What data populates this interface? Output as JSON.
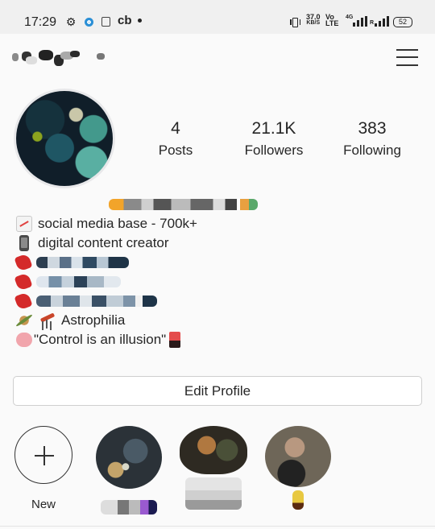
{
  "status_bar": {
    "time": "17:29",
    "notification_icons": [
      "gear-icon",
      "circle-app-icon",
      "calculator-icon"
    ],
    "carrier_tag": "cb",
    "net_speed_value": "37.0",
    "net_speed_unit": "KB/S",
    "volte_top": "Vo",
    "volte_bottom": "LTE",
    "network_type": "4G",
    "roaming_flag": "R",
    "battery_level": "52"
  },
  "header": {
    "username": "(blurred)",
    "menu_icon": "hamburger-menu-icon"
  },
  "stats": {
    "posts": {
      "value": "4",
      "label": "Posts"
    },
    "followers": {
      "value": "21.1K",
      "label": "Followers"
    },
    "following": {
      "value": "383",
      "label": "Following"
    }
  },
  "bio": {
    "name_line": "(blurred)",
    "lines": [
      {
        "icon": "chart-increasing-icon",
        "text": "social media base - 700k+"
      },
      {
        "icon": "mobile-phone-icon",
        "text": "digital content creator"
      },
      {
        "icon": "heart-icon",
        "text": "(blurred)"
      },
      {
        "icon": "heart-icon",
        "text": "(blurred)"
      },
      {
        "icon": "heart-icon",
        "text": "(blurred)"
      },
      {
        "icon": "planet-telescope-icon",
        "text": "Astrophilia"
      },
      {
        "icon": "brain-icon",
        "text": "\"Control is an illusion\""
      }
    ]
  },
  "edit_profile": {
    "label": "Edit Profile"
  },
  "highlights": [
    {
      "type": "new",
      "label": "New"
    },
    {
      "type": "story",
      "label": "(blurred)"
    },
    {
      "type": "story",
      "label": "(blurred)"
    },
    {
      "type": "story",
      "label": "(blurred)"
    }
  ],
  "colors": {
    "background": "#fafafa",
    "text": "#262626",
    "status_bar_bg": "#f0f0f0",
    "button_border": "#cfcfcf"
  }
}
